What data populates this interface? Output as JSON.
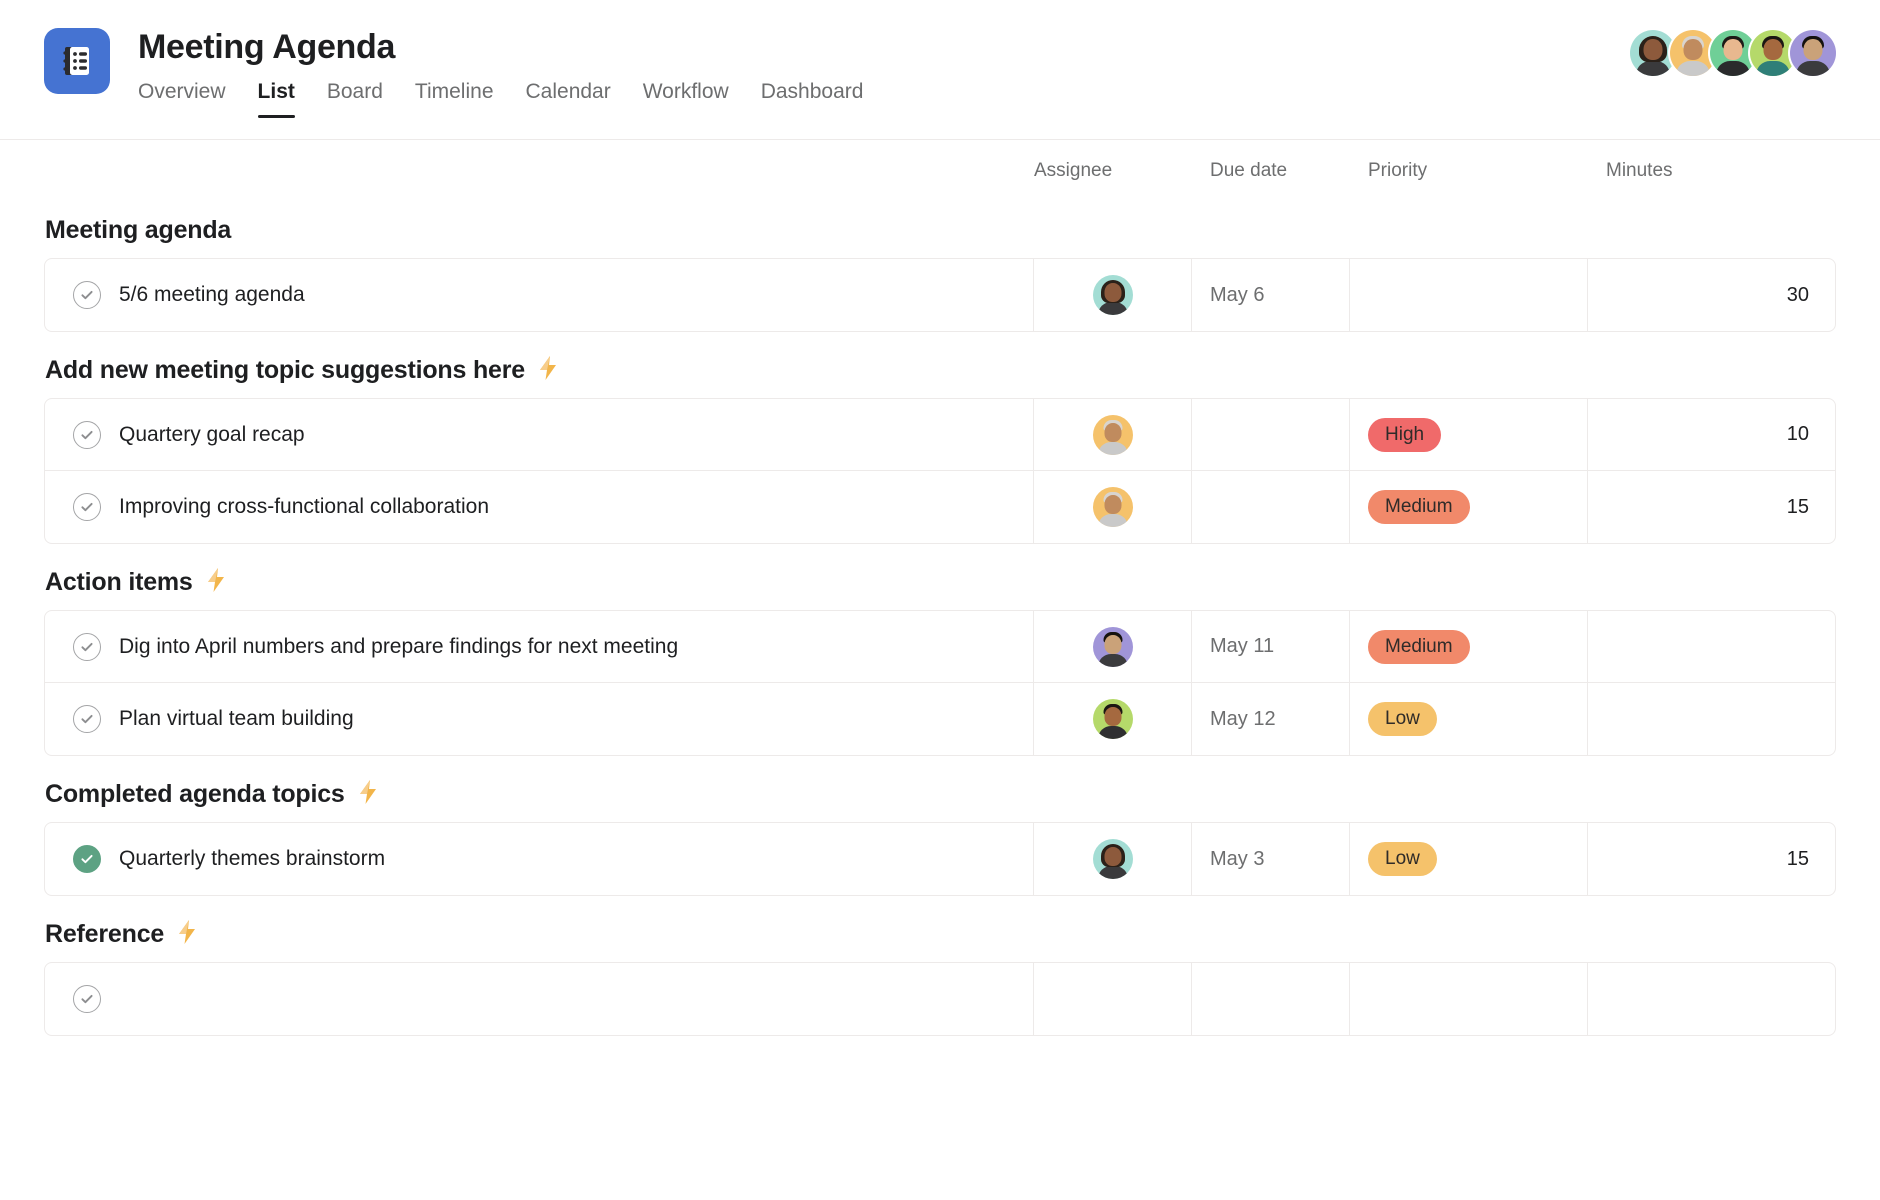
{
  "header": {
    "app_icon_name": "notebook-list-icon",
    "brand_color": "#4573d2",
    "title": "Meeting Agenda",
    "tabs": [
      {
        "label": "Overview",
        "active": false
      },
      {
        "label": "List",
        "active": true
      },
      {
        "label": "Board",
        "active": false
      },
      {
        "label": "Timeline",
        "active": false
      },
      {
        "label": "Calendar",
        "active": false
      },
      {
        "label": "Workflow",
        "active": false
      },
      {
        "label": "Dashboard",
        "active": false
      }
    ],
    "members": [
      {
        "name": "member-avatar-1",
        "bg": "#a3ddd4",
        "skin": "#8d5a3c",
        "hair": "#2b2119",
        "hair_style": "long",
        "shirt": "#3a3a3c"
      },
      {
        "name": "member-avatar-2",
        "bg": "#f5c26b",
        "skin": "#c08b5e",
        "hair": "#d8d4cf",
        "hair_style": "short",
        "shirt": "#c9c9c9"
      },
      {
        "name": "member-avatar-3",
        "bg": "#6fcf97",
        "skin": "#e8b88f",
        "hair": "#1d1a17",
        "hair_style": "short",
        "shirt": "#2a2a2c"
      },
      {
        "name": "member-avatar-4",
        "bg": "#b5d96a",
        "skin": "#a5693f",
        "hair": "#1c1713",
        "hair_style": "short",
        "shirt": "#2f7f78"
      },
      {
        "name": "member-avatar-5",
        "bg": "#a095d8",
        "skin": "#caa279",
        "hair": "#15120f",
        "hair_style": "short",
        "shirt": "#3b3b3d"
      }
    ]
  },
  "columns": {
    "task": "",
    "assignee": "Assignee",
    "due_date": "Due date",
    "priority": "Priority",
    "minutes": "Minutes"
  },
  "priority_colors": {
    "High": "#f06a6a",
    "Medium": "#f1896a",
    "Low": "#f5c26b"
  },
  "sections": [
    {
      "title": "Meeting agenda",
      "has_bolt": false,
      "bolt": "",
      "rows": [
        {
          "task": "5/6 meeting agenda",
          "completed": false,
          "assignee": {
            "name": "assignee-avatar",
            "bg": "#a3ddd4",
            "skin": "#8d5a3c",
            "hair": "#2b2119",
            "hair_style": "long",
            "shirt": "#3a3a3c"
          },
          "due": "May 6",
          "priority": "",
          "minutes": "30"
        }
      ]
    },
    {
      "title": "Add new meeting topic suggestions here",
      "has_bolt": true,
      "bolt": "⚡",
      "rows": [
        {
          "task": "Quartery goal recap",
          "completed": false,
          "assignee": {
            "name": "assignee-avatar",
            "bg": "#f5c26b",
            "skin": "#c08b5e",
            "hair": "#d8d4cf",
            "hair_style": "short",
            "shirt": "#c9c9c9"
          },
          "due": "",
          "priority": "High",
          "minutes": "10"
        },
        {
          "task": "Improving cross-functional collaboration",
          "completed": false,
          "assignee": {
            "name": "assignee-avatar",
            "bg": "#f5c26b",
            "skin": "#c08b5e",
            "hair": "#d8d4cf",
            "hair_style": "short",
            "shirt": "#c9c9c9"
          },
          "due": "",
          "priority": "Medium",
          "minutes": "15"
        }
      ]
    },
    {
      "title": "Action items",
      "has_bolt": true,
      "bolt": "⚡",
      "rows": [
        {
          "task": "Dig into April numbers and prepare findings for next meeting",
          "completed": false,
          "assignee": {
            "name": "assignee-avatar",
            "bg": "#a095d8",
            "skin": "#caa279",
            "hair": "#15120f",
            "hair_style": "short",
            "shirt": "#3b3b3d"
          },
          "due": "May 11",
          "priority": "Medium",
          "minutes": ""
        },
        {
          "task": "Plan virtual team building",
          "completed": false,
          "assignee": {
            "name": "assignee-avatar",
            "bg": "#b5d96a",
            "skin": "#a5693f",
            "hair": "#1c1713",
            "hair_style": "short",
            "shirt": "#2f2f31"
          },
          "due": "May 12",
          "priority": "Low",
          "minutes": ""
        }
      ]
    },
    {
      "title": "Completed agenda topics",
      "has_bolt": true,
      "bolt": "⚡",
      "rows": [
        {
          "task": "Quarterly themes brainstorm",
          "completed": true,
          "assignee": {
            "name": "assignee-avatar",
            "bg": "#a3ddd4",
            "skin": "#8d5a3c",
            "hair": "#2b2119",
            "hair_style": "long",
            "shirt": "#3a3a3c"
          },
          "due": "May 3",
          "priority": "Low",
          "minutes": "15"
        }
      ]
    },
    {
      "title": "Reference",
      "has_bolt": true,
      "bolt": "⚡",
      "rows": []
    }
  ]
}
